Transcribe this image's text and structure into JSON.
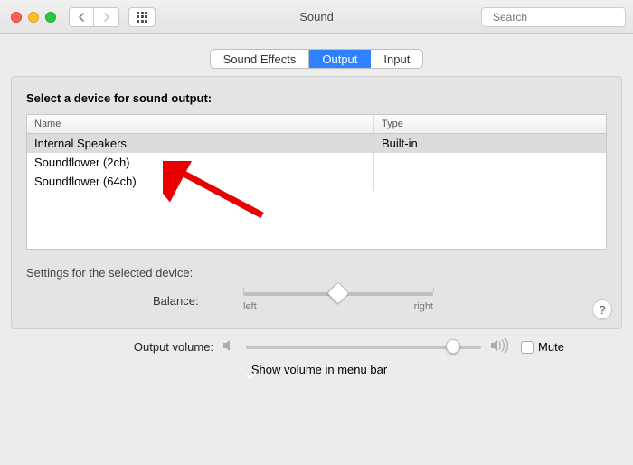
{
  "window": {
    "title": "Sound"
  },
  "search": {
    "placeholder": "Search"
  },
  "tabs": {
    "items": [
      {
        "label": "Sound Effects"
      },
      {
        "label": "Output"
      },
      {
        "label": "Input"
      }
    ],
    "active_index": 1
  },
  "section": {
    "heading": "Select a device for sound output:",
    "columns": {
      "name": "Name",
      "type": "Type"
    },
    "devices": [
      {
        "name": "Internal Speakers",
        "type": "Built-in",
        "selected": true
      },
      {
        "name": "Soundflower (2ch)",
        "type": "",
        "selected": false
      },
      {
        "name": "Soundflower (64ch)",
        "type": "",
        "selected": false
      }
    ],
    "settings_label": "Settings for the selected device:"
  },
  "balance": {
    "label": "Balance:",
    "left_label": "left",
    "right_label": "right",
    "value_percent": 50
  },
  "output_volume": {
    "label": "Output volume:",
    "value_percent": 88
  },
  "mute": {
    "label": "Mute",
    "checked": false
  },
  "show_in_menu_bar": {
    "label": "Show volume in menu bar",
    "checked": true
  },
  "help_glyph": "?",
  "colors": {
    "accent": "#2f82ff"
  }
}
